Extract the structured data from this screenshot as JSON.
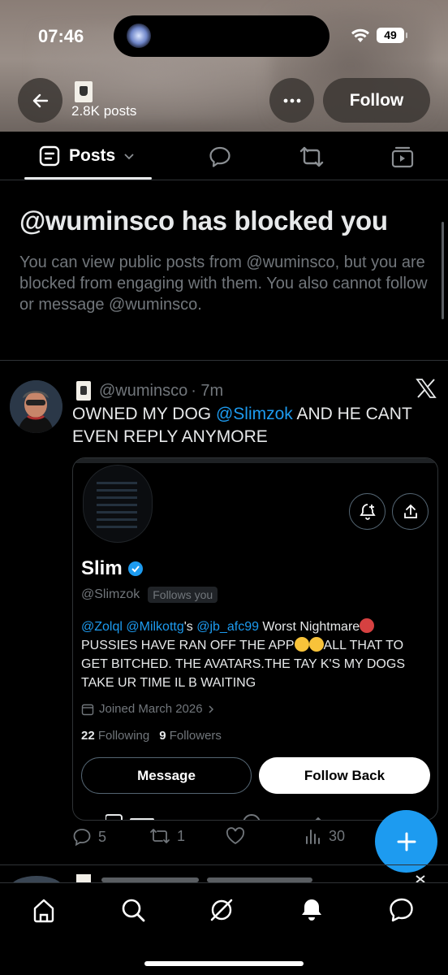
{
  "status_bar": {
    "time": "07:46",
    "battery": "49"
  },
  "header": {
    "posts_count": "2.8K posts",
    "follow_label": "Follow"
  },
  "tabs": {
    "posts_label": "Posts"
  },
  "blocked": {
    "title": "@wuminsco has blocked you",
    "message": "You can view public posts from @wuminsco, but you are blocked from engaging with them. You also cannot follow or message @wuminsco."
  },
  "tweet": {
    "handle": "@wuminsco",
    "time": "· 7m",
    "text_before": "OWNED MY DOG ",
    "mention": "@Slimzok",
    "text_after": " AND HE CANT EVEN REPLY ANYMORE",
    "embed": {
      "name": "Slim",
      "handle": "@Slimzok",
      "follows_badge": "Follows you",
      "bio_mention1": "@Zolql",
      "bio_mention2": "@Milkottg",
      "bio_possessive": "'s ",
      "bio_mention3": "@jb_afc99",
      "bio_part1": " Worst Nightmare",
      "bio_part2": "PUSSIES HAVE RAN OFF THE APP",
      "bio_part3": "ALL THAT TO GET BITCHED. THE AVATARS.THE TAY K'S MY DOGS TAKE UR TIME IL B WAITING",
      "joined": "Joined March 2026",
      "following_count": "22",
      "following_label": "Following",
      "followers_count": "9",
      "followers_label": "Followers",
      "message_label": "Message",
      "follow_back_label": "Follow Back"
    },
    "actions": {
      "replies": "5",
      "reposts": "1",
      "likes": "",
      "views": "30"
    }
  },
  "colors": {
    "accent": "#1d9bf0",
    "muted": "#71767b",
    "divider": "#2f3336"
  }
}
